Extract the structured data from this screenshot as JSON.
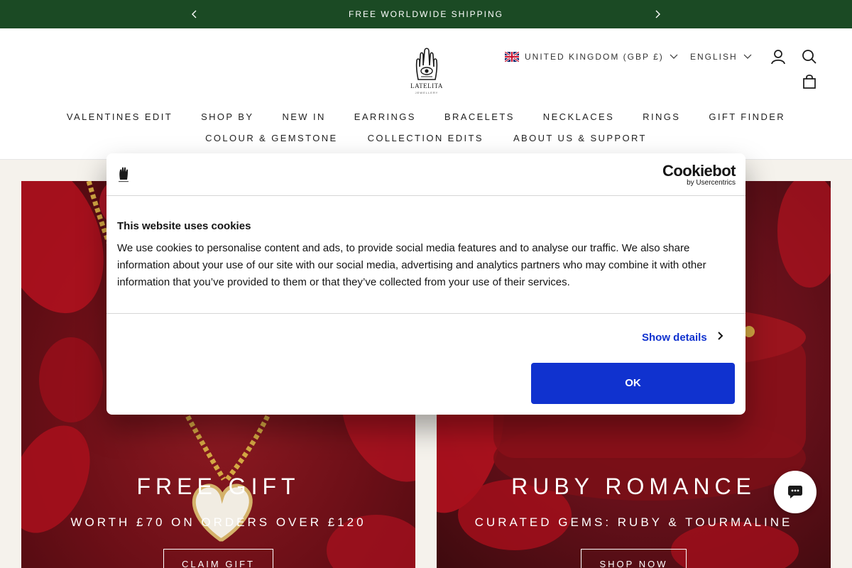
{
  "announcement": {
    "text": "FREE WORLDWIDE SHIPPING"
  },
  "brand": {
    "name": "LATELITA",
    "tagline": "JEWELLERY"
  },
  "locale": {
    "country": "UNITED KINGDOM (GBP £)",
    "language": "ENGLISH"
  },
  "nav": {
    "row1": [
      "VALENTINES EDIT",
      "SHOP BY",
      "NEW IN",
      "EARRINGS",
      "BRACELETS",
      "NECKLACES",
      "RINGS",
      "GIFT FINDER"
    ],
    "row2": [
      "COLOUR & GEMSTONE",
      "COLLECTION EDITS",
      "ABOUT US & SUPPORT"
    ]
  },
  "hero": {
    "left": {
      "heading": "FREE GIFT",
      "subheading": "WORTH £70 ON ORDERS OVER £120",
      "button": "CLAIM GIFT"
    },
    "right": {
      "heading": "RUBY ROMANCE",
      "subheading": "CURATED GEMS: RUBY & TOURMALINE",
      "button": "SHOP NOW"
    }
  },
  "cookie": {
    "brand": "Cookiebot",
    "brand_by": "by Usercentrics",
    "title": "This website uses cookies",
    "body": "We use cookies to personalise content and ads, to provide social media features and to analyse our traffic. We also share information about your use of our site with our social media, advertising and analytics partners who may combine it with other information that you’ve provided to them or that they’ve collected from your use of their services.",
    "details_label": "Show details",
    "ok_label": "OK"
  },
  "colors": {
    "announcement_bg": "#1b4a24",
    "accent_blue": "#1032cf",
    "hero_red": "#7a121b"
  },
  "icons": [
    "chevron-left-icon",
    "chevron-right-icon",
    "uk-flag-icon",
    "chevron-down-icon",
    "account-icon",
    "search-icon",
    "bag-icon",
    "chat-icon"
  ]
}
